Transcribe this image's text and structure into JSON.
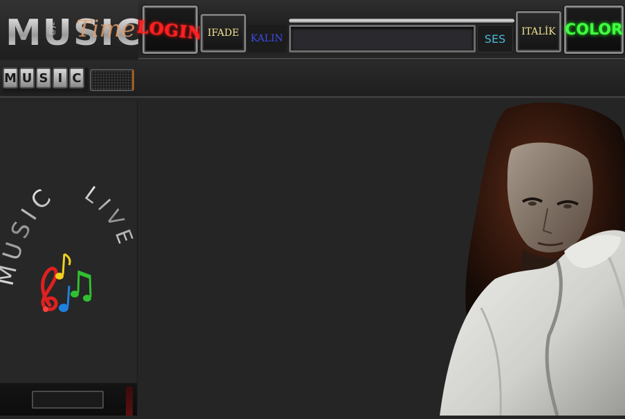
{
  "logo": {
    "main_text": "MUSIC",
    "script_text": "Time",
    "small_text": "@yz"
  },
  "toolbar": {
    "login_label": "LOGIN",
    "ifade_label": "IFADE",
    "kalin_label": "KALIN",
    "message_value": "",
    "ses_label": "SES",
    "italik_label": "ITALİK",
    "color_label": "COLOR"
  },
  "subbar": {
    "music_tab_letters": [
      "M",
      "U",
      "S",
      "I",
      "C"
    ]
  },
  "sidebar": {
    "art_text_left": "MUSIC",
    "art_text_right": "LIVE"
  },
  "colors": {
    "background": "#252525",
    "login_red": "#ff2020",
    "color_green": "#40ff40",
    "kalin_blue": "#3c4ce8",
    "ses_cyan": "#4ab8d8",
    "ifade_gold": "#f0e090",
    "note_red": "#e02020",
    "note_yellow": "#f0d020",
    "note_blue": "#2080e0",
    "note_green": "#30c030"
  }
}
